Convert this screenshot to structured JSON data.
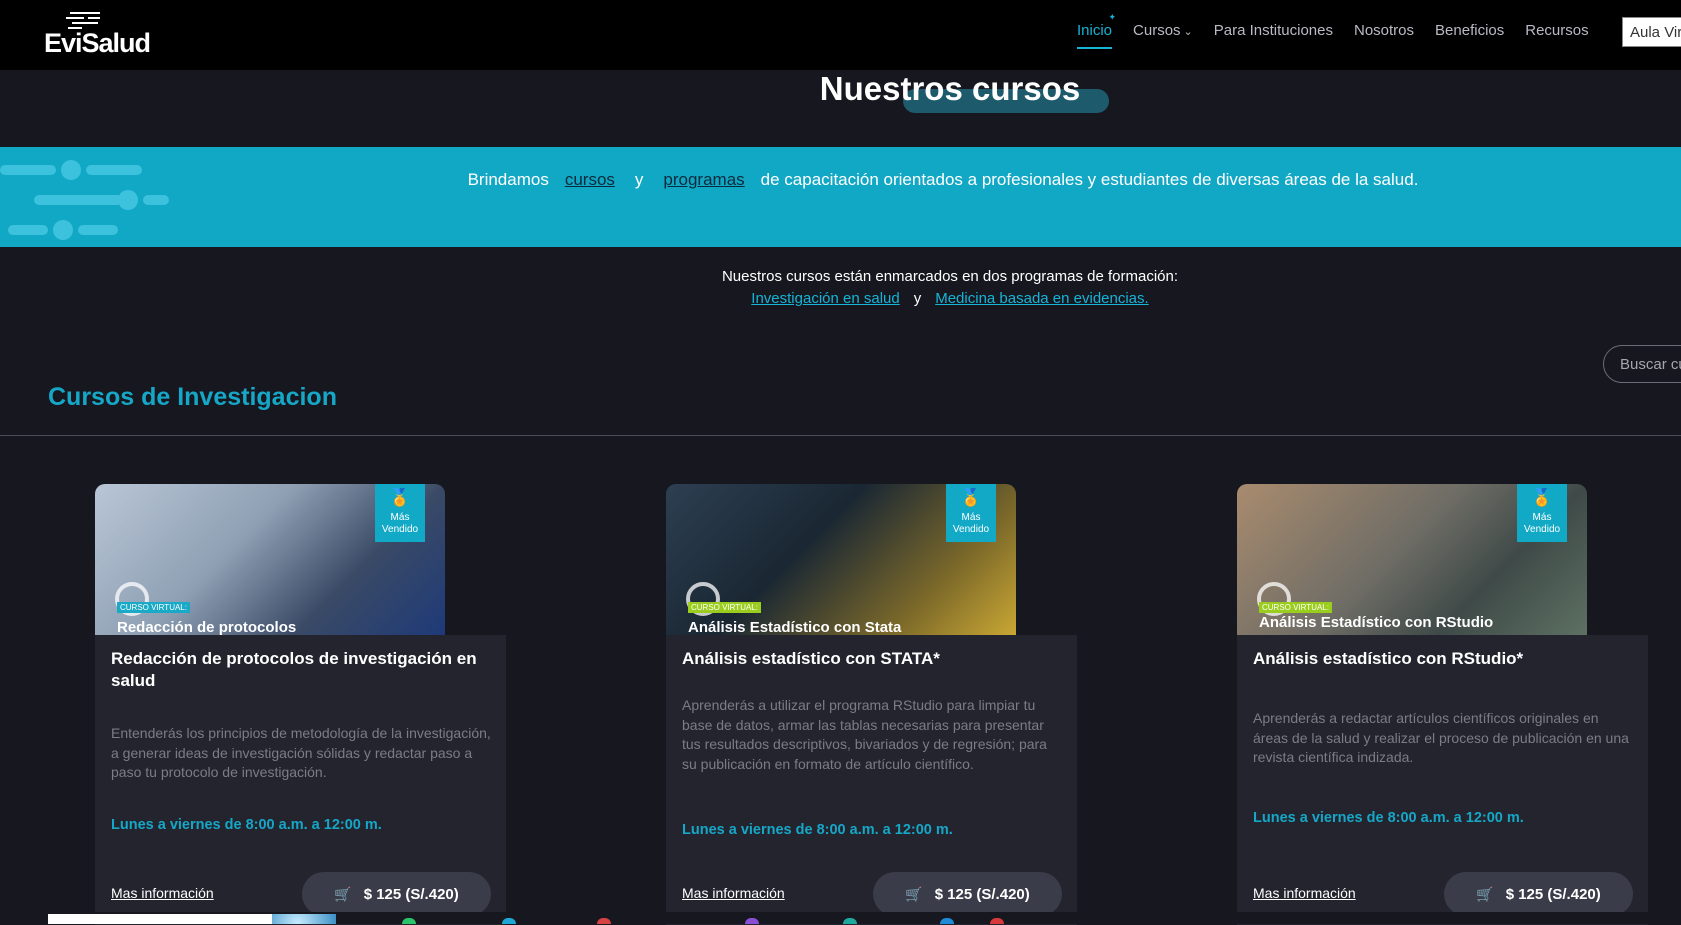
{
  "header": {
    "logo_text": "EviSalud",
    "nav": [
      {
        "label": "Inicio",
        "active": true
      },
      {
        "label": "Cursos",
        "has_dropdown": true
      },
      {
        "label": "Para Instituciones"
      },
      {
        "label": "Nosotros"
      },
      {
        "label": "Beneficios"
      },
      {
        "label": "Recursos"
      }
    ],
    "aula_button": "Aula Virtual"
  },
  "hero": {
    "title": "Nuestros cursos",
    "band_prefix": "Brindamos",
    "band_link1": "cursos",
    "band_y": "y",
    "band_link2": "programas",
    "band_suffix": "de capacitación orientados a profesionales y estudiantes de diversas áreas de la salud."
  },
  "programs": {
    "intro": "Nuestros cursos están enmarcados en dos programas de formación:",
    "link1": "Investigación en salud",
    "y": "y",
    "link2": "Medicina basada en evidencias."
  },
  "search": {
    "placeholder": "Buscar cursos"
  },
  "section": {
    "title": "Cursos de Investigacion"
  },
  "cards": [
    {
      "badge": "Más Vendido",
      "image_tag": "CURSO VIRTUAL:",
      "image_caption": "Redacción de protocolos",
      "title": "Redacción de protocolos de investigación en salud",
      "description": "Entenderás los principios de metodología de la investigación, a generar ideas de investigación sólidas y redactar paso a paso tu protocolo de investigación.",
      "schedule": "Lunes a viernes de 8:00 a.m. a 12:00 m.",
      "more": "Mas información",
      "price": "$ 125 (S/.420)"
    },
    {
      "badge": "Más Vendido",
      "image_tag": "CURSO VIRTUAL:",
      "image_caption": "Análisis Estadístico con Stata",
      "title": "Análisis estadístico con STATA*",
      "description": "Aprenderás a utilizar el programa RStudio para limpiar tu base de datos, armar las tablas necesarias para presentar tus resultados descriptivos, bivariados y de regresión; para su publicación en formato de artículo científico.",
      "schedule": "Lunes a viernes de 8:00 a.m. a 12:00 m.",
      "more": "Mas información",
      "price": "$ 125 (S/.420)"
    },
    {
      "badge": "Más Vendido",
      "image_tag": "CURSO VIRTUAL:",
      "image_caption": "Análisis Estadístico con RStudio",
      "title": "Análisis estadístico con RStudio*",
      "description": "Aprenderás a redactar artículos científicos originales en áreas de la salud y realizar el proceso de publicación en una revista científica indizada.",
      "schedule": "Lunes a viernes de 8:00 a.m. a 12:00 m.",
      "more": "Mas información",
      "price": "$ 125 (S/.420)"
    }
  ],
  "colors": {
    "accent": "#16b4d6",
    "band": "#11a8c6",
    "background": "#16171f",
    "card": "#23242e"
  }
}
